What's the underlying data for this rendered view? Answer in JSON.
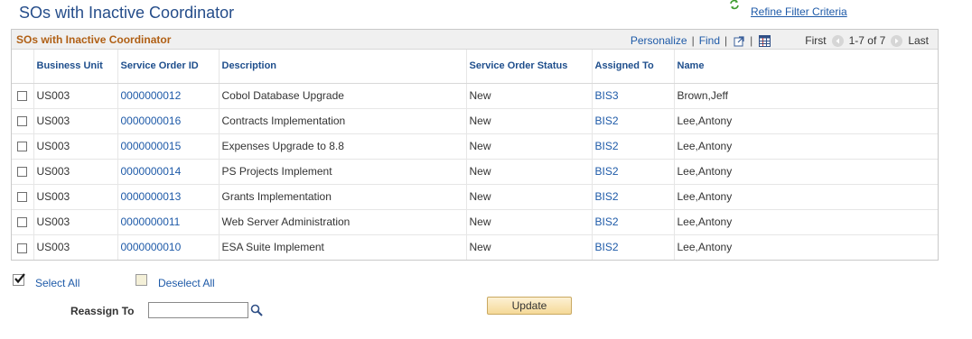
{
  "page": {
    "title": "SOs with Inactive Coordinator",
    "refine_link": "Refine Filter Criteria"
  },
  "grid": {
    "title": "SOs with Inactive Coordinator",
    "tools": {
      "personalize": "Personalize",
      "separator": "|",
      "find": "Find",
      "first": "First",
      "range": "1-7 of 7",
      "last": "Last"
    },
    "columns": [
      "Business Unit",
      "Service Order ID",
      "Description",
      "Service Order Status",
      "Assigned To",
      "Name"
    ],
    "rows": [
      {
        "bu": "US003",
        "so_id": "0000000012",
        "desc": "Cobol Database Upgrade",
        "status": "New",
        "assigned": "BIS3",
        "name": "Brown,Jeff"
      },
      {
        "bu": "US003",
        "so_id": "0000000016",
        "desc": "Contracts Implementation",
        "status": "New",
        "assigned": "BIS2",
        "name": "Lee,Antony"
      },
      {
        "bu": "US003",
        "so_id": "0000000015",
        "desc": "Expenses Upgrade to 8.8",
        "status": "New",
        "assigned": "BIS2",
        "name": "Lee,Antony"
      },
      {
        "bu": "US003",
        "so_id": "0000000014",
        "desc": "PS Projects Implement",
        "status": "New",
        "assigned": "BIS2",
        "name": "Lee,Antony"
      },
      {
        "bu": "US003",
        "so_id": "0000000013",
        "desc": "Grants Implementation",
        "status": "New",
        "assigned": "BIS2",
        "name": "Lee,Antony"
      },
      {
        "bu": "US003",
        "so_id": "0000000011",
        "desc": "Web Server Administration",
        "status": "New",
        "assigned": "BIS2",
        "name": "Lee,Antony"
      },
      {
        "bu": "US003",
        "so_id": "0000000010",
        "desc": "ESA Suite Implement",
        "status": "New",
        "assigned": "BIS2",
        "name": "Lee,Antony"
      }
    ]
  },
  "actions": {
    "select_all": "Select All",
    "deselect_all": "Deselect All",
    "reassign_label": "Reassign To",
    "reassign_value": "",
    "update": "Update"
  },
  "colors": {
    "title": "#254d8a",
    "grid_title": "#b05f14",
    "link": "#1e5aa8"
  }
}
